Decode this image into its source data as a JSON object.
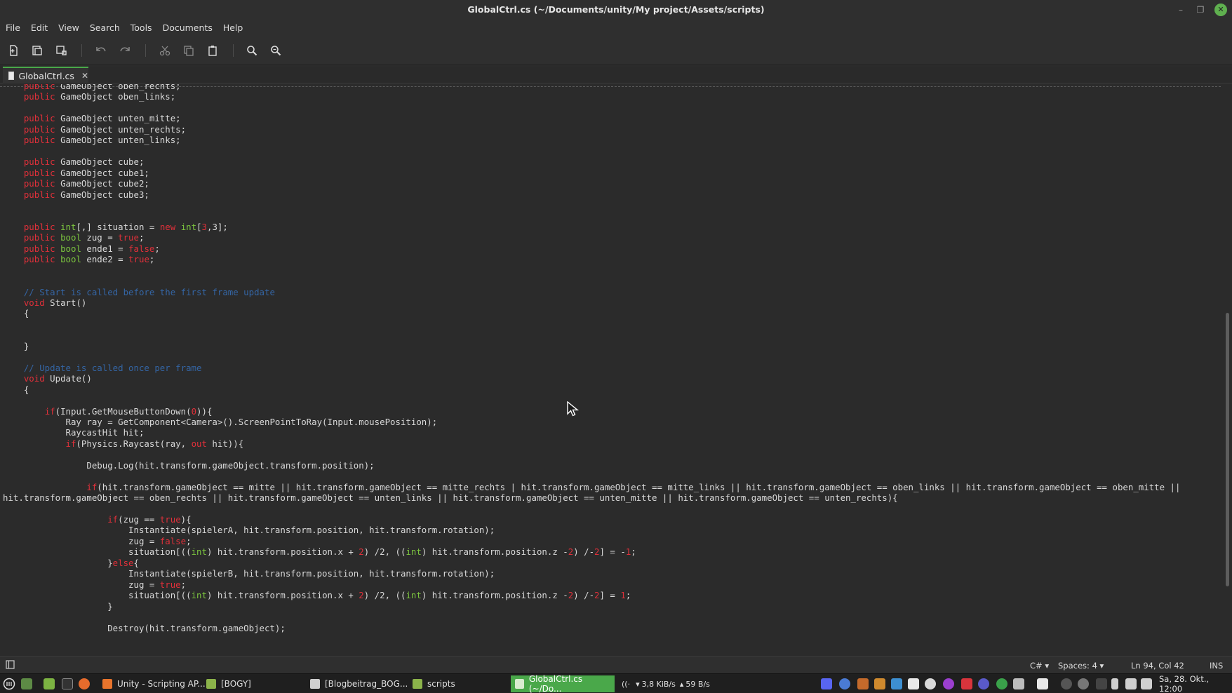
{
  "window": {
    "title": "GlobalCtrl.cs (~/Documents/unity/My project/Assets/scripts)",
    "minimize_glyph": "–",
    "maximize_glyph": "❐",
    "close_glyph": "✕"
  },
  "menu": [
    "File",
    "Edit",
    "View",
    "Search",
    "Tools",
    "Documents",
    "Help"
  ],
  "toolbar": {
    "icons": [
      "new-document-icon",
      "open-icon",
      "save-icon",
      "undo-icon",
      "redo-icon",
      "cut-icon",
      "copy-icon",
      "paste-icon",
      "search-icon",
      "replace-icon"
    ]
  },
  "tab": {
    "label": "GlobalCtrl.cs",
    "close": "✕"
  },
  "code": {
    "lines": [
      "    public GameObject oben_rechts;",
      "    public GameObject oben_links;",
      "",
      "    public GameObject unten_mitte;",
      "    public GameObject unten_rechts;",
      "    public GameObject unten_links;",
      "",
      "    public GameObject cube;",
      "    public GameObject cube1;",
      "    public GameObject cube2;",
      "    public GameObject cube3;",
      "",
      "",
      "    public int[,] situation = new int[3,3];",
      "    public bool zug = true;",
      "    public bool ende1 = false;",
      "    public bool ende2 = true;",
      "",
      "",
      "    // Start is called before the first frame update",
      "    void Start()",
      "    {",
      "",
      "",
      "    }",
      "",
      "    // Update is called once per frame",
      "    void Update()",
      "    {",
      "",
      "        if(Input.GetMouseButtonDown(0)){",
      "            Ray ray = GetComponent<Camera>().ScreenPointToRay(Input.mousePosition);",
      "            RaycastHit hit;",
      "            if(Physics.Raycast(ray, out hit)){",
      "",
      "                Debug.Log(hit.transform.gameObject.transform.position);",
      "",
      "                if(hit.transform.gameObject == mitte || hit.transform.gameObject == mitte_rechts | hit.transform.gameObject == mitte_links || hit.transform.gameObject == oben_links || hit.transform.gameObject == oben_mitte ||",
      "hit.transform.gameObject == oben_rechts || hit.transform.gameObject == unten_links || hit.transform.gameObject == unten_mitte || hit.transform.gameObject == unten_rechts){",
      "",
      "                    if(zug == true){",
      "                        Instantiate(spielerA, hit.transform.position, hit.transform.rotation);",
      "                        zug = false;",
      "                        situation[((int) hit.transform.position.x + 2) /2, ((int) hit.transform.position.z -2) /-2] = -1;",
      "                    }else{",
      "                        Instantiate(spielerB, hit.transform.position, hit.transform.rotation);",
      "                        zug = true;",
      "                        situation[((int) hit.transform.position.x + 2) /2, ((int) hit.transform.position.z -2) /-2] = 1;",
      "                    }",
      "",
      "                    Destroy(hit.transform.gameObject);",
      ""
    ]
  },
  "statusbar": {
    "language": "C#",
    "spaces": "Spaces: 4",
    "position": "Ln 94, Col 42",
    "mode": "INS"
  },
  "taskbar": {
    "windows": [
      {
        "label": "Unity - Scripting AP...",
        "active": false
      },
      {
        "label": "[BOGY]",
        "active": false
      },
      {
        "label": "[Blogbeitrag_BOG...",
        "active": false
      },
      {
        "label": "scripts",
        "active": false
      },
      {
        "label": "GlobalCtrl.cs (~/Do...",
        "active": true
      }
    ],
    "network": "3,8 KiB/s",
    "network2": "59 B/s",
    "clock": "Sa, 28. Okt., 12:00"
  },
  "colors": {
    "keyword": "#e0303a",
    "type": "#7cc53f",
    "comment": "#3465a4",
    "accent": "#4aa84a"
  }
}
